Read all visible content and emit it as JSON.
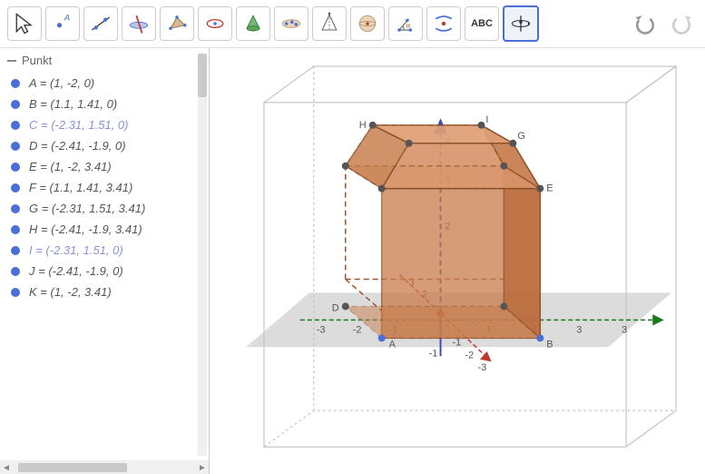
{
  "toolbar": {
    "tools": [
      "move",
      "point",
      "line",
      "perp",
      "polygon",
      "circle",
      "cone",
      "points-set",
      "pyramid",
      "sphere",
      "angle",
      "intersect",
      "text",
      "rotate-view"
    ],
    "text_label": "ABC"
  },
  "sidebar": {
    "group_label": "Punkt",
    "points": [
      {
        "name": "A",
        "coords": "(1, -2, 0)",
        "alt": false
      },
      {
        "name": "B",
        "coords": "(1.1, 1.41, 0)",
        "alt": false
      },
      {
        "name": "C",
        "coords": "(-2.31, 1.51, 0)",
        "alt": true
      },
      {
        "name": "D",
        "coords": "(-2.41, -1.9, 0)",
        "alt": false
      },
      {
        "name": "E",
        "coords": "(1, -2, 3.41)",
        "alt": false
      },
      {
        "name": "F",
        "coords": "(1.1, 1.41, 3.41)",
        "alt": false
      },
      {
        "name": "G",
        "coords": "(-2.31, 1.51, 3.41)",
        "alt": false
      },
      {
        "name": "H",
        "coords": "(-2.41, -1.9, 3.41)",
        "alt": false
      },
      {
        "name": "I",
        "coords": "(-2.31, 1.51, 0)",
        "alt": true
      },
      {
        "name": "J",
        "coords": "(-2.41, -1.9, 0)",
        "alt": false
      },
      {
        "name": "K",
        "coords": "(1, -2, 3.41)",
        "alt": false
      }
    ]
  },
  "view3d": {
    "point_labels": [
      "A",
      "B",
      "D",
      "E",
      "G",
      "H",
      "I"
    ],
    "axis_ticks_x": [
      "-3",
      "-2",
      "-1",
      "1",
      "2",
      "3"
    ],
    "axis_ticks_y": [
      "-1",
      "-2",
      "-3"
    ],
    "axis_ticks_z": [
      "2",
      "3",
      "4"
    ],
    "y_neg_ticks": [
      "3",
      "2"
    ]
  }
}
